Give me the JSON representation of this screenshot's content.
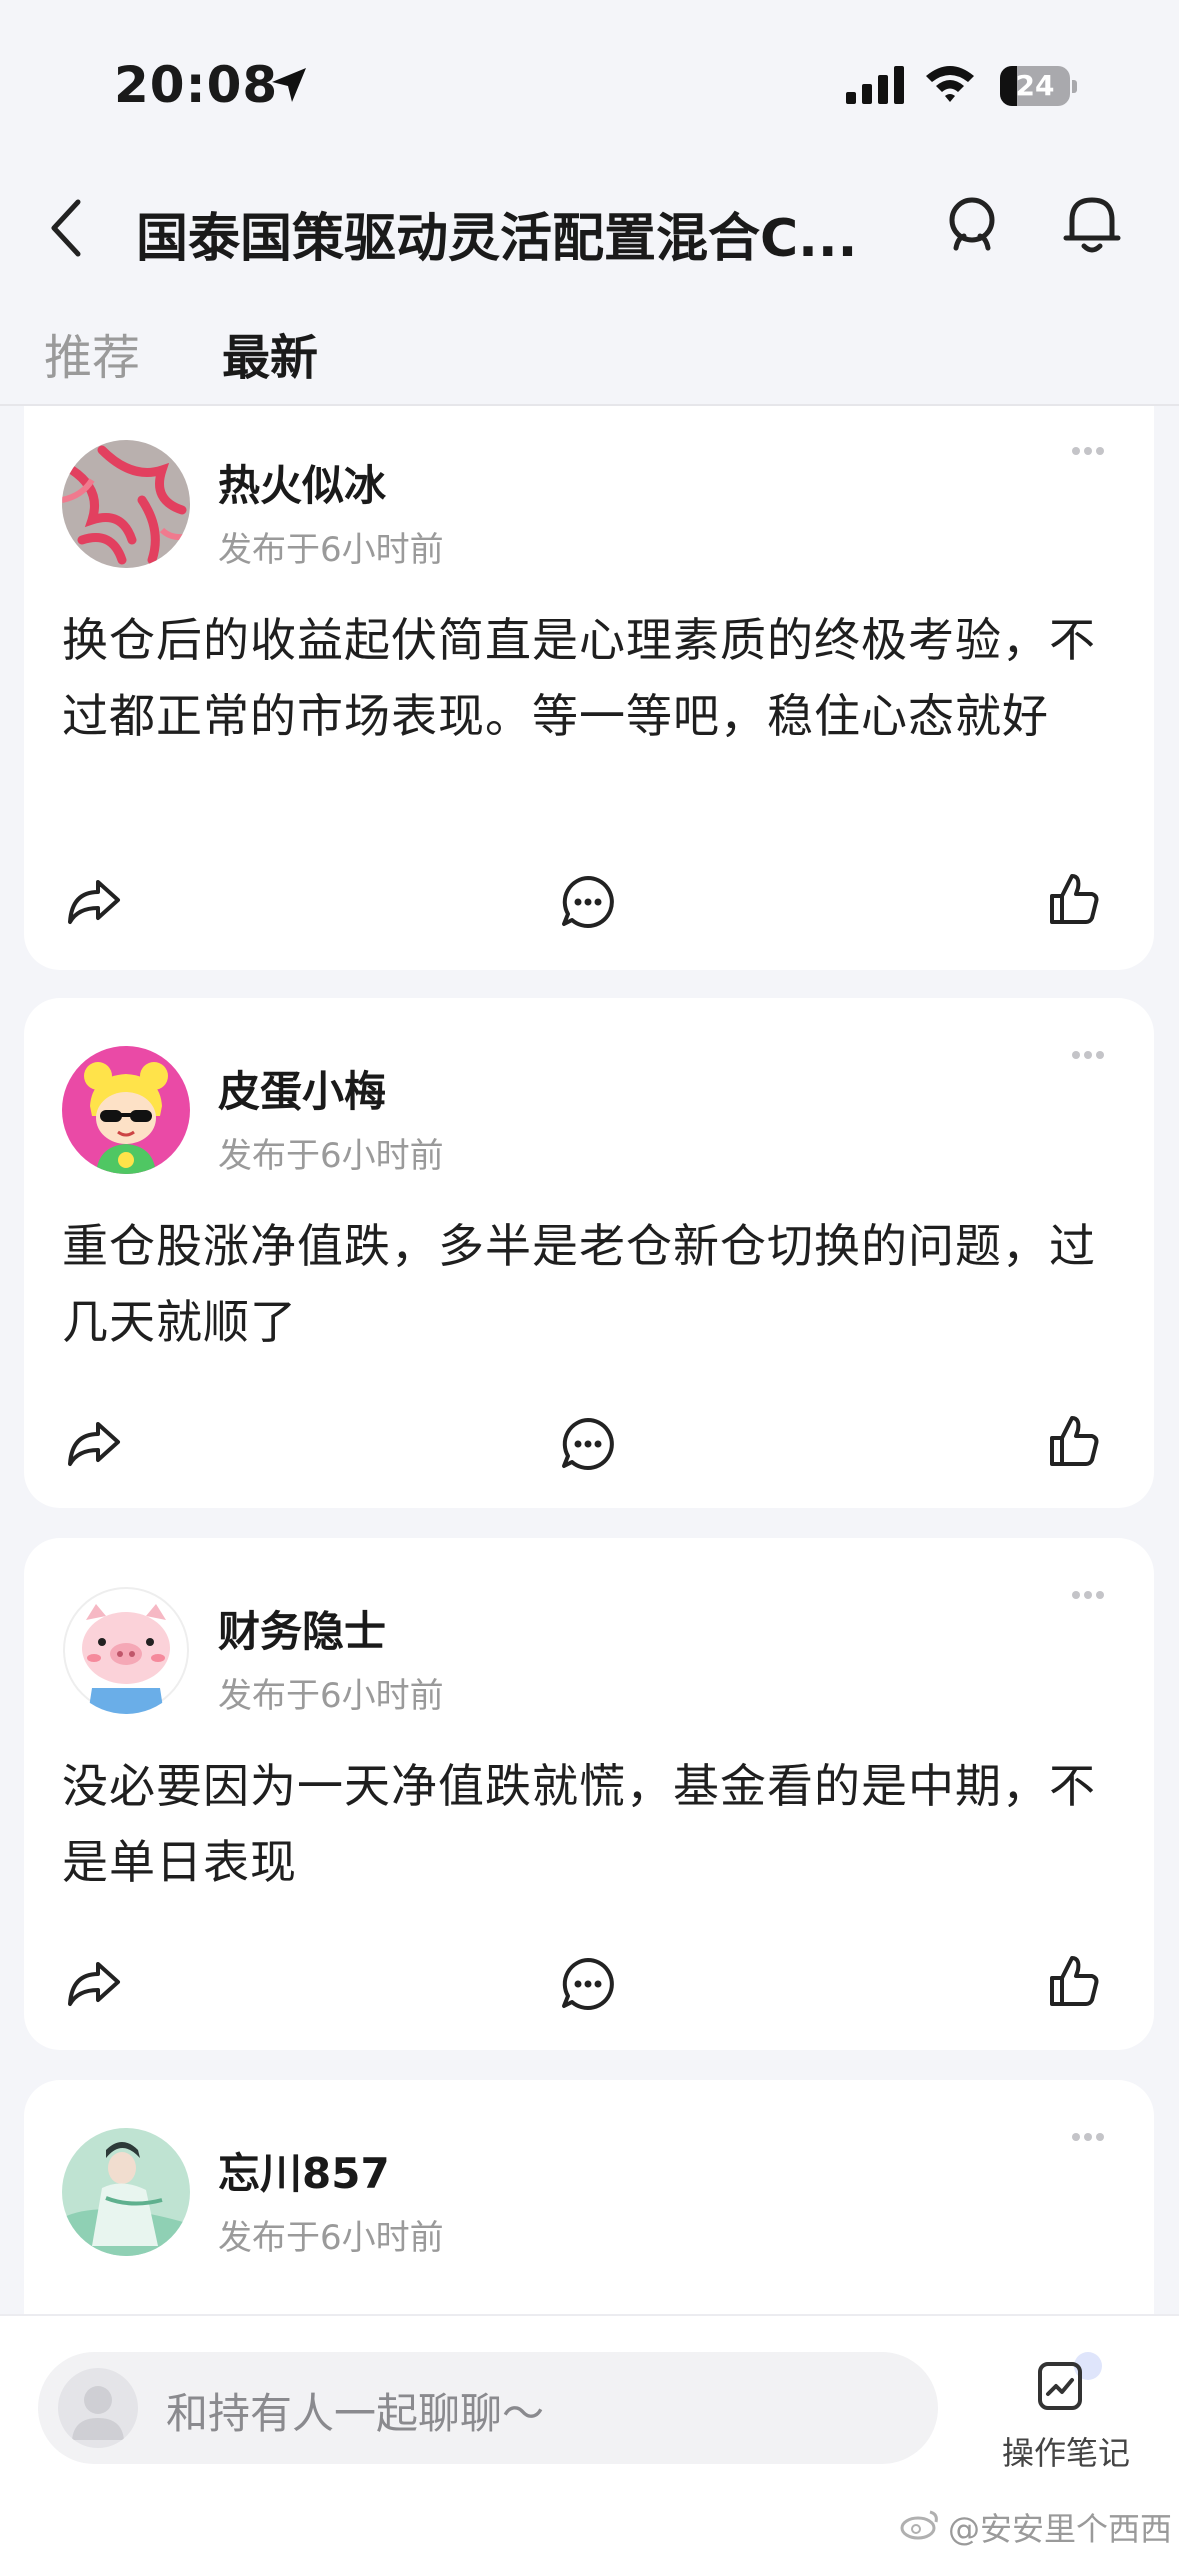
{
  "status_bar": {
    "time": "20:08",
    "battery_level": "24",
    "battery_fraction": 0.24
  },
  "header": {
    "title": "国泰国策驱动灵活配置混合C..."
  },
  "tabs": [
    {
      "label": "推荐",
      "active": false
    },
    {
      "label": "最新",
      "active": true
    }
  ],
  "posts": [
    {
      "username": "热火似冰",
      "time": "发布于6小时前",
      "content": "换仓后的收益起伏简直是心理素质的终极考验，不过都正常的市场表现。等一等吧，稳住心态就好",
      "avatar_icon": "pink-texture-avatar"
    },
    {
      "username": "皮蛋小梅",
      "time": "发布于6小时前",
      "content": "重仓股涨净值跌，多半是老仓新仓切换的问题，过几天就顺了",
      "avatar_icon": "cartoon-girl-avatar"
    },
    {
      "username": "财务隐士",
      "time": "发布于6小时前",
      "content": "没必要因为一天净值跌就慌，基金看的是中期，不是单日表现",
      "avatar_icon": "pig-avatar"
    },
    {
      "username": "忘川857",
      "time": "发布于6小时前",
      "content": "",
      "avatar_icon": "painted-figure-avatar"
    }
  ],
  "bottom_bar": {
    "chat_placeholder": "和持有人一起聊聊～",
    "notes_label": "操作笔记"
  },
  "watermark": "@安安里个西西",
  "colors": {
    "background": "#f4f5f9",
    "card": "#ffffff",
    "muted_text": "#9a9a9a",
    "title_text": "#1a1a1a"
  }
}
